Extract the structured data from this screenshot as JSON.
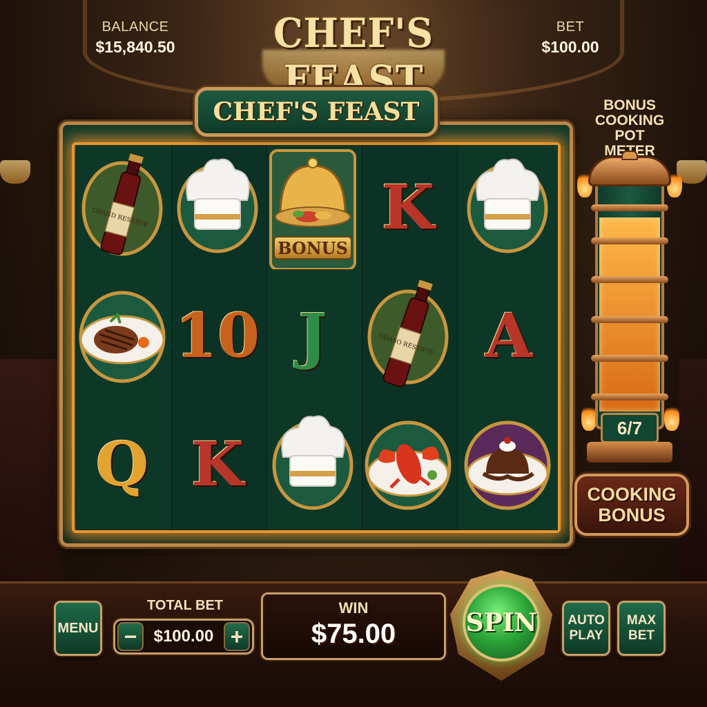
{
  "header": {
    "title": "CHEF'S FEAST",
    "balance_label": "BALANCE",
    "balance_value": "$15,840.50",
    "bet_label": "BET",
    "bet_value": "$100.00"
  },
  "reels": {
    "title": "CHEF'S FEAST",
    "grid": [
      [
        "wine-bottle-icon",
        "chef-hat-icon",
        "bonus-cloche-icon",
        "K",
        "chef-hat-icon"
      ],
      [
        "steak-plate-icon",
        "10",
        "J",
        "wine-bottle-icon",
        "A"
      ],
      [
        "Q",
        "K",
        "chef-hat-icon",
        "lobster-plate-icon",
        "lava-cake-icon"
      ]
    ],
    "bonus_label": "BONUS",
    "wine_label_1": "GRAND RESERVE",
    "wine_label_2": "ODASO RESERTE"
  },
  "meter": {
    "title_line1": "BONUS",
    "title_line2": "COOKING POT",
    "title_line3": "METER",
    "count": "6/7",
    "fill_level": 0.857,
    "bonus_line1": "COOKING",
    "bonus_line2": "BONUS"
  },
  "controls": {
    "menu_label": "MENU",
    "total_bet_label": "TOTAL BET",
    "total_bet_value": "$100.00",
    "minus_label": "−",
    "plus_label": "+",
    "win_label": "WIN",
    "win_value": "$75.00",
    "spin_label": "SPIN",
    "autoplay_line1": "AUTO",
    "autoplay_line2": "PLAY",
    "maxbet_line1": "MAX",
    "maxbet_line2": "BET"
  },
  "colors": {
    "felt_green": "#0d3828",
    "gold": "#c8963e",
    "glow_orange": "#e7952c",
    "spin_green": "#2ea83a"
  }
}
